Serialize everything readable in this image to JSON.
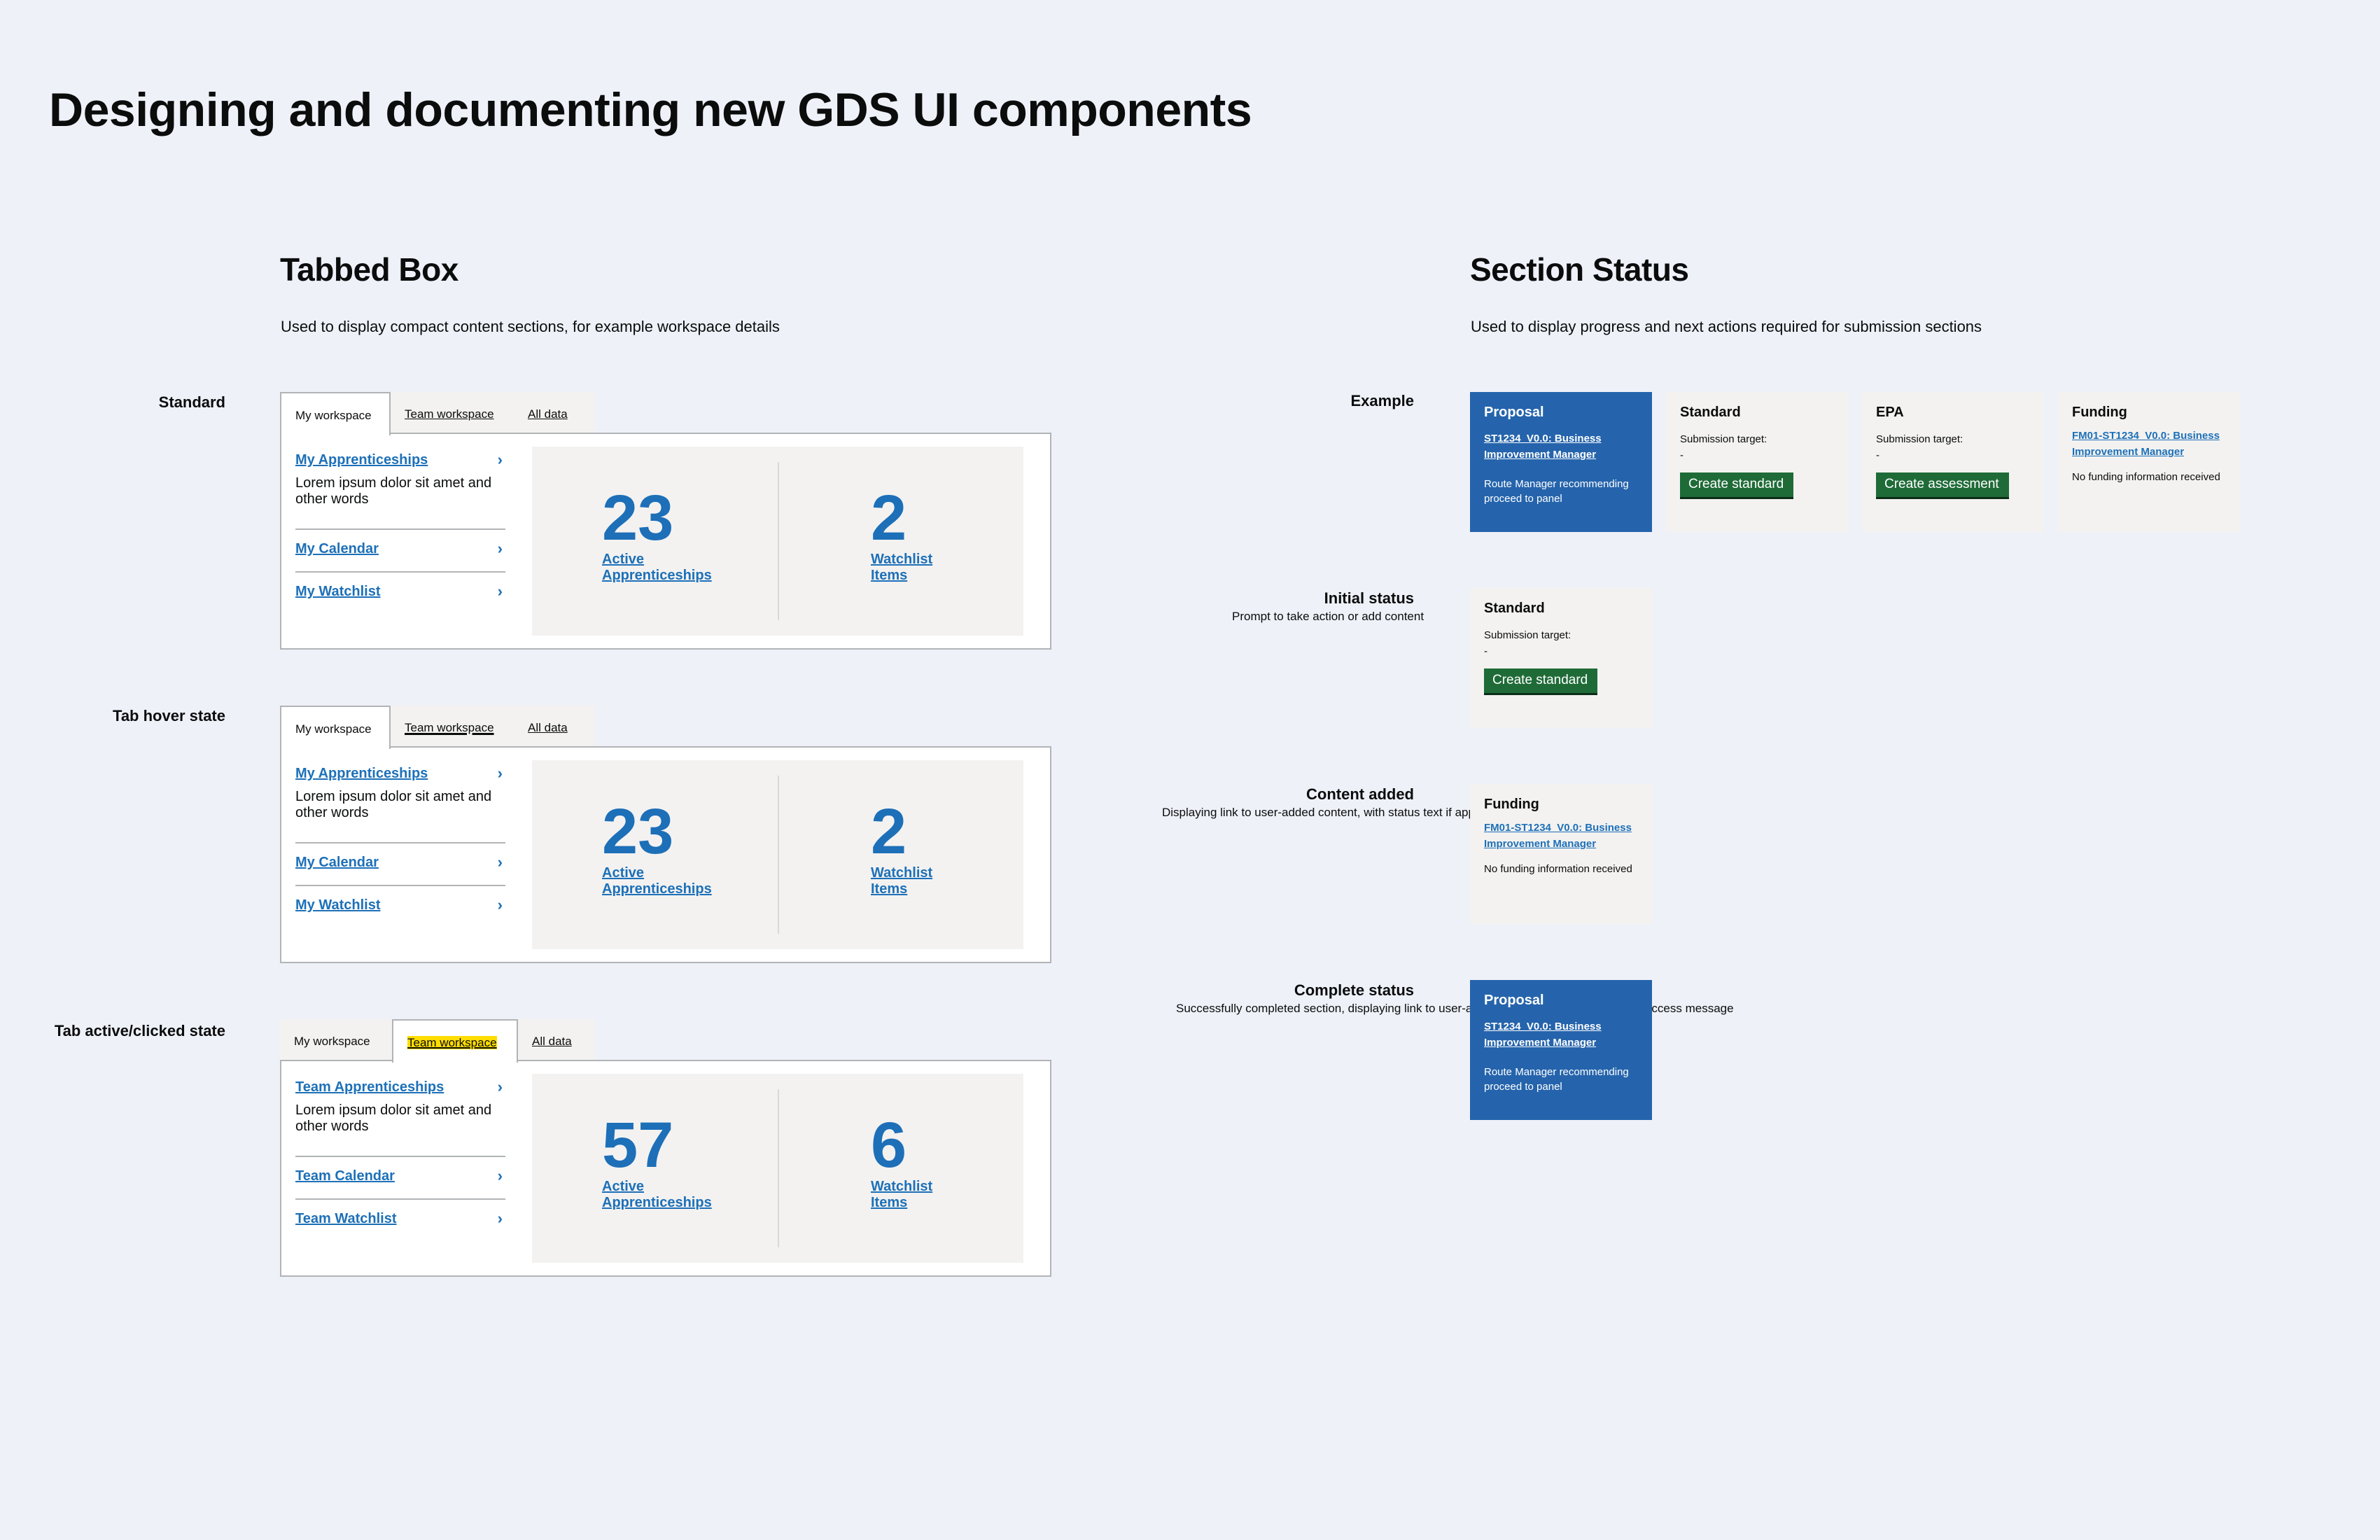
{
  "page": {
    "title": "Designing and documenting new GDS UI components"
  },
  "tabbed_box": {
    "title": "Tabbed Box",
    "description": "Used to display compact content sections, for example workspace details",
    "variants": [
      {
        "label": "Standard",
        "tabs": [
          "My workspace",
          "Team workspace",
          "All data"
        ],
        "nav": [
          {
            "link": "My Apprenticeships",
            "desc": "Lorem ipsum dolor sit amet and other words"
          },
          {
            "link": "My Calendar"
          },
          {
            "link": "My Watchlist"
          }
        ],
        "stats": [
          {
            "value": "23",
            "label": "Active\nApprenticeships"
          },
          {
            "value": "2",
            "label": "Watchlist\nItems"
          }
        ]
      },
      {
        "label": "Tab hover state",
        "tabs": [
          "My workspace",
          "Team workspace",
          "All data"
        ],
        "nav": [
          {
            "link": "My Apprenticeships",
            "desc": "Lorem ipsum dolor sit amet and other words"
          },
          {
            "link": "My Calendar"
          },
          {
            "link": "My Watchlist"
          }
        ],
        "stats": [
          {
            "value": "23",
            "label": "Active\nApprenticeships"
          },
          {
            "value": "2",
            "label": "Watchlist\nItems"
          }
        ]
      },
      {
        "label": "Tab active/clicked state",
        "tabs": [
          "My workspace",
          "Team workspace",
          "All data"
        ],
        "nav": [
          {
            "link": "Team Apprenticeships",
            "desc": "Lorem ipsum dolor sit amet and other words"
          },
          {
            "link": "Team Calendar"
          },
          {
            "link": "Team Watchlist"
          }
        ],
        "stats": [
          {
            "value": "57",
            "label": "Active\nApprenticeships"
          },
          {
            "value": "6",
            "label": "Watchlist\nItems"
          }
        ]
      }
    ]
  },
  "section_status": {
    "title": "Section Status",
    "description": "Used to display progress and next actions required for submission sections",
    "rows": {
      "example": {
        "label": "Example"
      },
      "initial": {
        "label": "Initial status",
        "desc": "Prompt to take action or add content"
      },
      "content": {
        "label": "Content added",
        "desc": "Displaying link to user-added content, with status text if applicable"
      },
      "complete": {
        "label": "Complete status",
        "desc": "Successfully completed section, displaying link to user-added content, displaying status/success message"
      }
    },
    "cards": {
      "proposal": {
        "title": "Proposal",
        "link": "ST1234_V0.0: Business Improvement Manager",
        "status": "Route Manager recommending proceed to panel"
      },
      "standard": {
        "title": "Standard",
        "label": "Submission target:",
        "dash": "-",
        "button": "Create standard"
      },
      "epa": {
        "title": "EPA",
        "label": "Submission target:",
        "dash": "-",
        "button": "Create assessment"
      },
      "funding": {
        "title": "Funding",
        "link": "FM01-ST1234_V0.0: Business Improvement Manager",
        "note": "No funding information received"
      }
    }
  }
}
